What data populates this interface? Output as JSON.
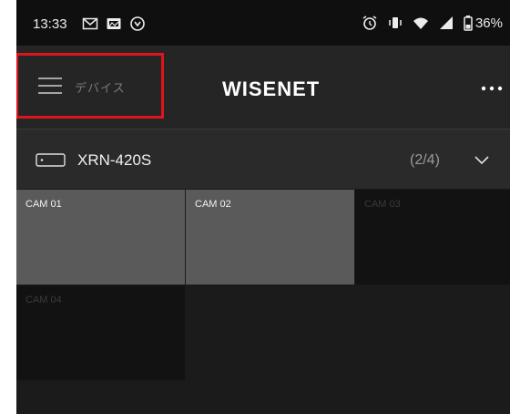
{
  "status_bar": {
    "time": "13:33",
    "left_icons": [
      "gmail-icon",
      "photo-icon",
      "sync-icon"
    ],
    "right_icons": [
      "alarm-icon",
      "vibrate-icon",
      "wifi-icon",
      "signal-icon",
      "battery-icon"
    ],
    "battery": "36%"
  },
  "app_bar": {
    "menu_label": "デバイス",
    "logo": "WISENET",
    "highlight_color": "#e0141d"
  },
  "device": {
    "name": "XRN-420S",
    "page": "(2/4)"
  },
  "cameras": [
    {
      "label": "CAM 01",
      "active": true
    },
    {
      "label": "CAM 02",
      "active": true
    },
    {
      "label": "CAM 03",
      "active": false
    },
    {
      "label": "CAM 04",
      "active": false
    }
  ]
}
